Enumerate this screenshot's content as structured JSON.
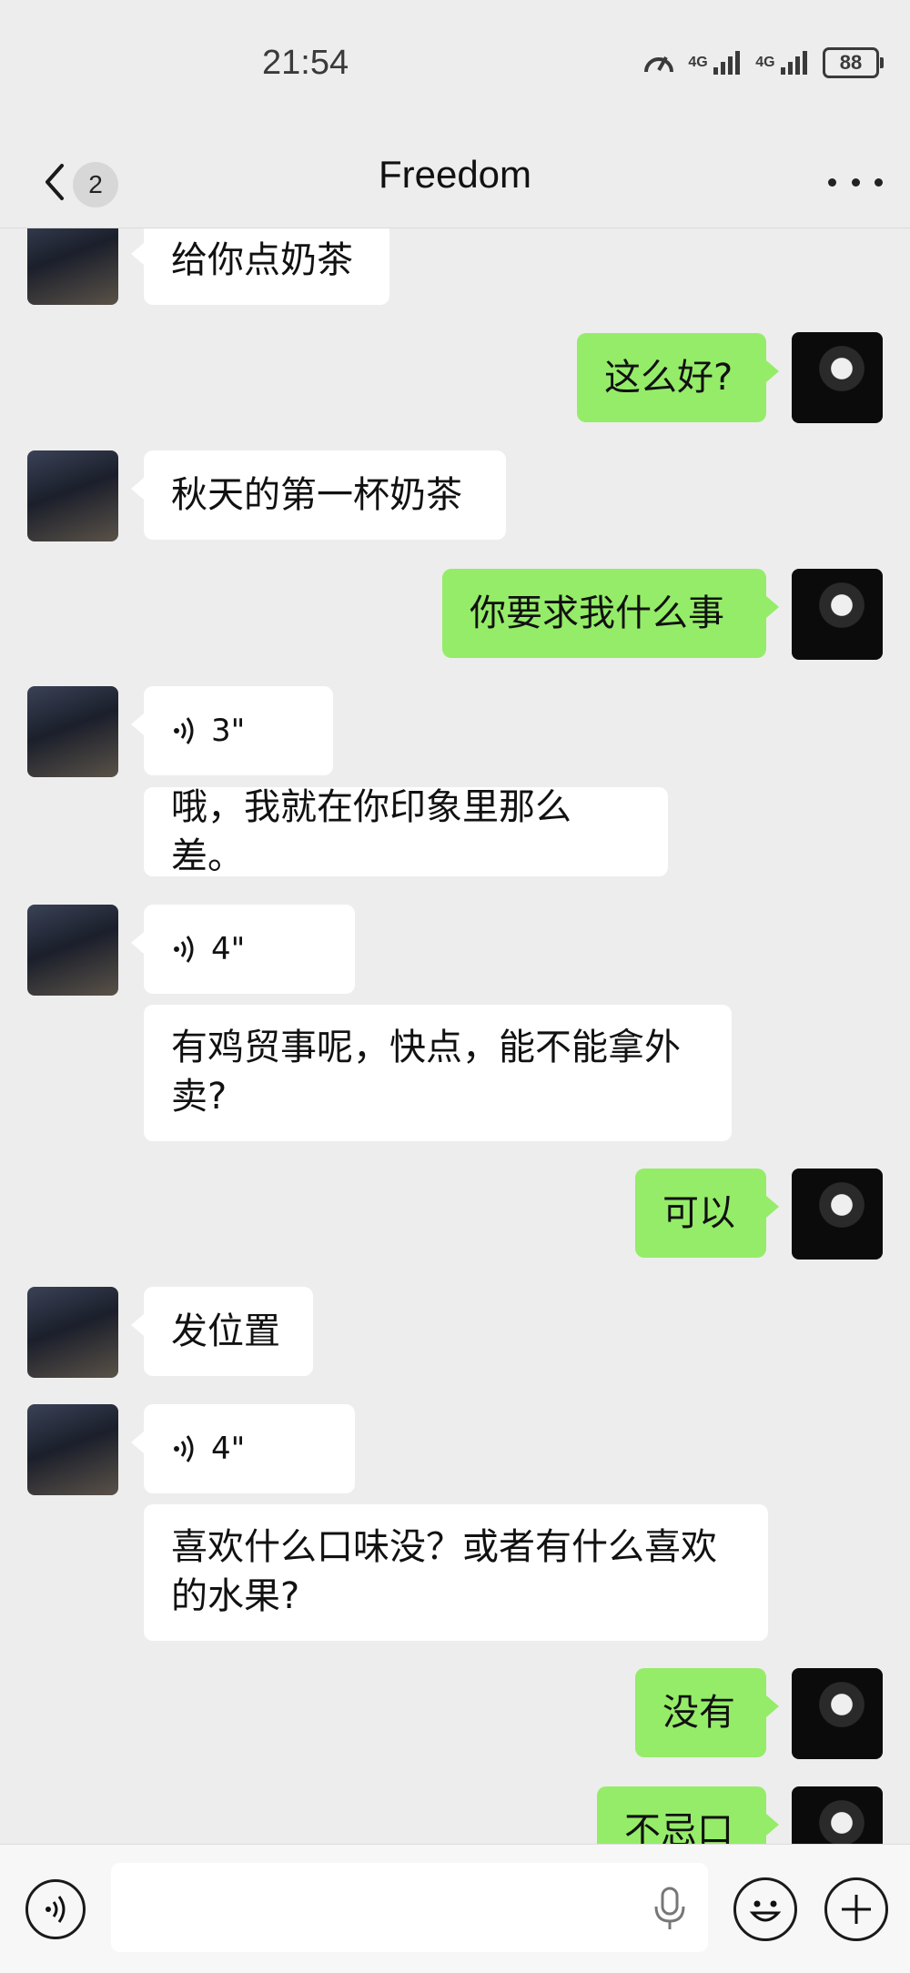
{
  "status": {
    "time": "21:54",
    "network_1": "4G",
    "network_2": "4G",
    "battery": "88"
  },
  "header": {
    "back_count": "2",
    "title": "Freedom"
  },
  "messages": [
    {
      "text": "给你点奶茶"
    },
    {
      "text": "这么好?"
    },
    {
      "text": "秋天的第一杯奶茶"
    },
    {
      "text": "你要求我什么事"
    },
    {
      "voice": "3\""
    },
    {
      "text": "哦，我就在你印象里那么差。"
    },
    {
      "voice": "4\""
    },
    {
      "text": "有鸡贸事呢，快点，能不能拿外卖?"
    },
    {
      "text": "可以"
    },
    {
      "text": "发位置"
    },
    {
      "voice": "4\""
    },
    {
      "text": "喜欢什么口味没？或者有什么喜欢的水果?"
    },
    {
      "text": "没有"
    },
    {
      "text": "不忌口"
    }
  ],
  "icons": {
    "back": "chevron-left-icon",
    "more": "more-dots-icon",
    "voice_mode": "voice-mode-icon",
    "mic": "microphone-icon",
    "emoji": "emoji-icon",
    "plus": "plus-icon"
  },
  "colors": {
    "background": "#ededed",
    "my_bubble": "#95ec69",
    "other_bubble": "#ffffff"
  }
}
